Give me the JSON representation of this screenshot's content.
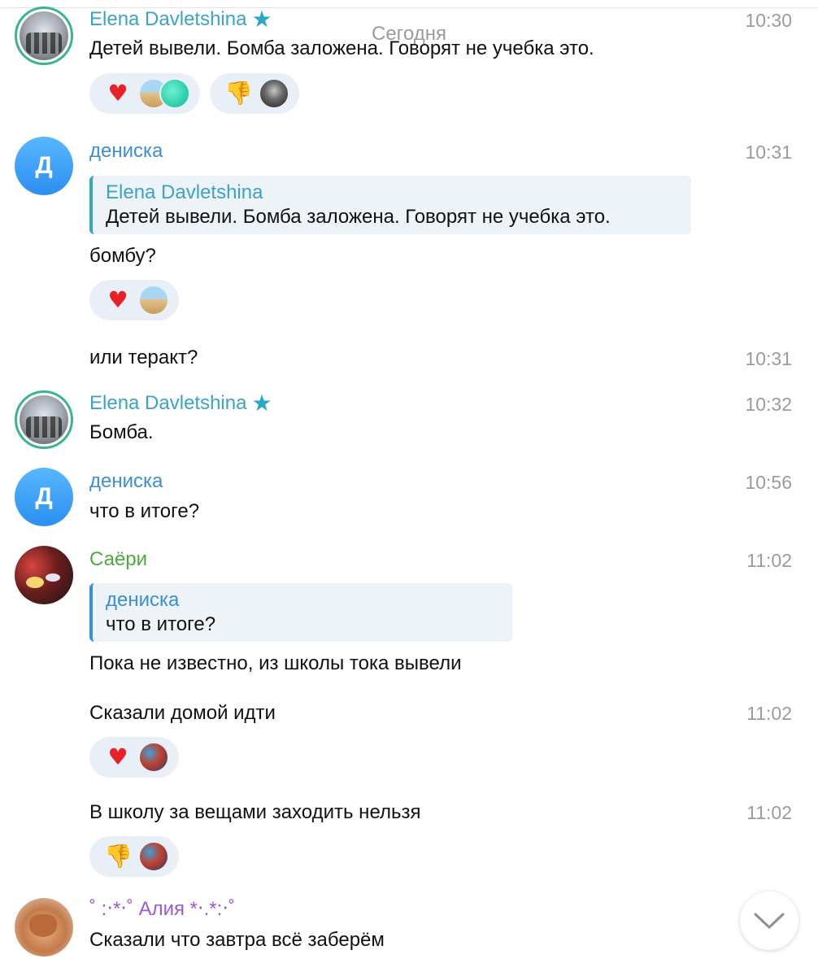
{
  "date_separator": "Сегодня",
  "messages": [
    {
      "sender": "Elena Davletshina",
      "time": "10:30",
      "text": "Детей вывели. Бомба заложена. Говорят  не учебка это."
    },
    {
      "sender": "дениска",
      "avatar_letter": "Д",
      "time": "10:31",
      "reply": {
        "sender": "Elena Davletshina",
        "text": "Детей вывели. Бомба заложена. Говорят  не учебка это."
      },
      "text": "бомбу?"
    },
    {
      "text": "или теракт?",
      "time": "10:31"
    },
    {
      "sender": "Elena Davletshina",
      "time": "10:32",
      "text": "Бомба."
    },
    {
      "sender": "дениска",
      "avatar_letter": "Д",
      "time": "10:56",
      "text": "что в итоге?"
    },
    {
      "sender": "Саёри",
      "time": "11:02",
      "reply": {
        "sender": "дениска",
        "text": "что в итоге?"
      },
      "text": "Пока не известно, из школы тока вывели"
    },
    {
      "text": "Сказали домой идти",
      "time": "11:02"
    },
    {
      "text": "В школу за вещами заходить нельзя",
      "time": "11:02"
    },
    {
      "sender": "˚ :‧*‧˚ Алия *‧.*:‧˚",
      "text": "Сказали что завтра всё заберём"
    }
  ],
  "reactions": {
    "heart": "♥",
    "thumbs_down": "👎"
  },
  "icons": {
    "star": "★",
    "scroll_down": "chevron-down-icon"
  },
  "colors": {
    "elena_name": "#3aa3c7",
    "den_name": "#3a8fd6",
    "saeri_name": "#4bab3c",
    "aliya_name": "#9b59d6",
    "reaction_bg": "#e9eff7",
    "time": "#9b9b9b"
  }
}
